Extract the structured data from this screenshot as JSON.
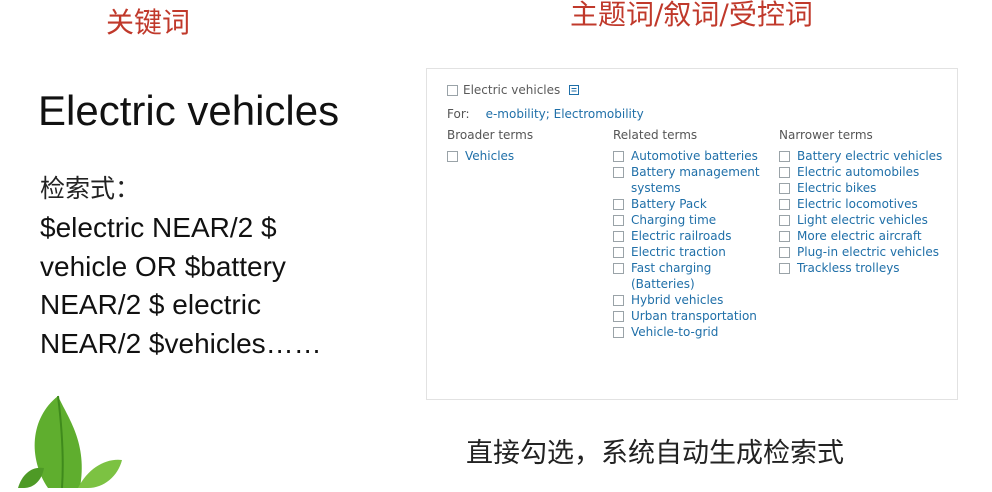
{
  "headings": {
    "keyword": "关键词",
    "thesaurus": "主题词/叙词/受控词"
  },
  "left": {
    "term": "Electric vehicles",
    "query_label": "检索式：",
    "query_lines": [
      "$electric NEAR/2 $",
      "vehicle OR $battery",
      "NEAR/2 $ electric",
      "NEAR/2 $vehicles……"
    ]
  },
  "panel": {
    "term": "Electric vehicles",
    "for_label": "For:",
    "for_values": "e-mobility; Electromobility",
    "broader": {
      "title": "Broader terms",
      "items": [
        "Vehicles"
      ]
    },
    "related": {
      "title": "Related terms",
      "items": [
        "Automotive batteries",
        "Battery management systems",
        "Battery Pack",
        "Charging time",
        "Electric railroads",
        "Electric traction",
        "Fast charging (Batteries)",
        "Hybrid vehicles",
        "Urban transportation",
        "Vehicle-to-grid"
      ]
    },
    "narrower": {
      "title": "Narrower terms",
      "items": [
        "Battery electric vehicles",
        "Electric automobiles",
        "Electric bikes",
        "Electric locomotives",
        "Light electric vehicles",
        "More electric aircraft",
        "Plug-in electric vehicles",
        "Trackless trolleys"
      ]
    }
  },
  "caption": "直接勾选，系统自动生成检索式",
  "colors": {
    "heading": "#c0392b",
    "link": "#1f6fa8",
    "leaf": "#5fae2e"
  }
}
